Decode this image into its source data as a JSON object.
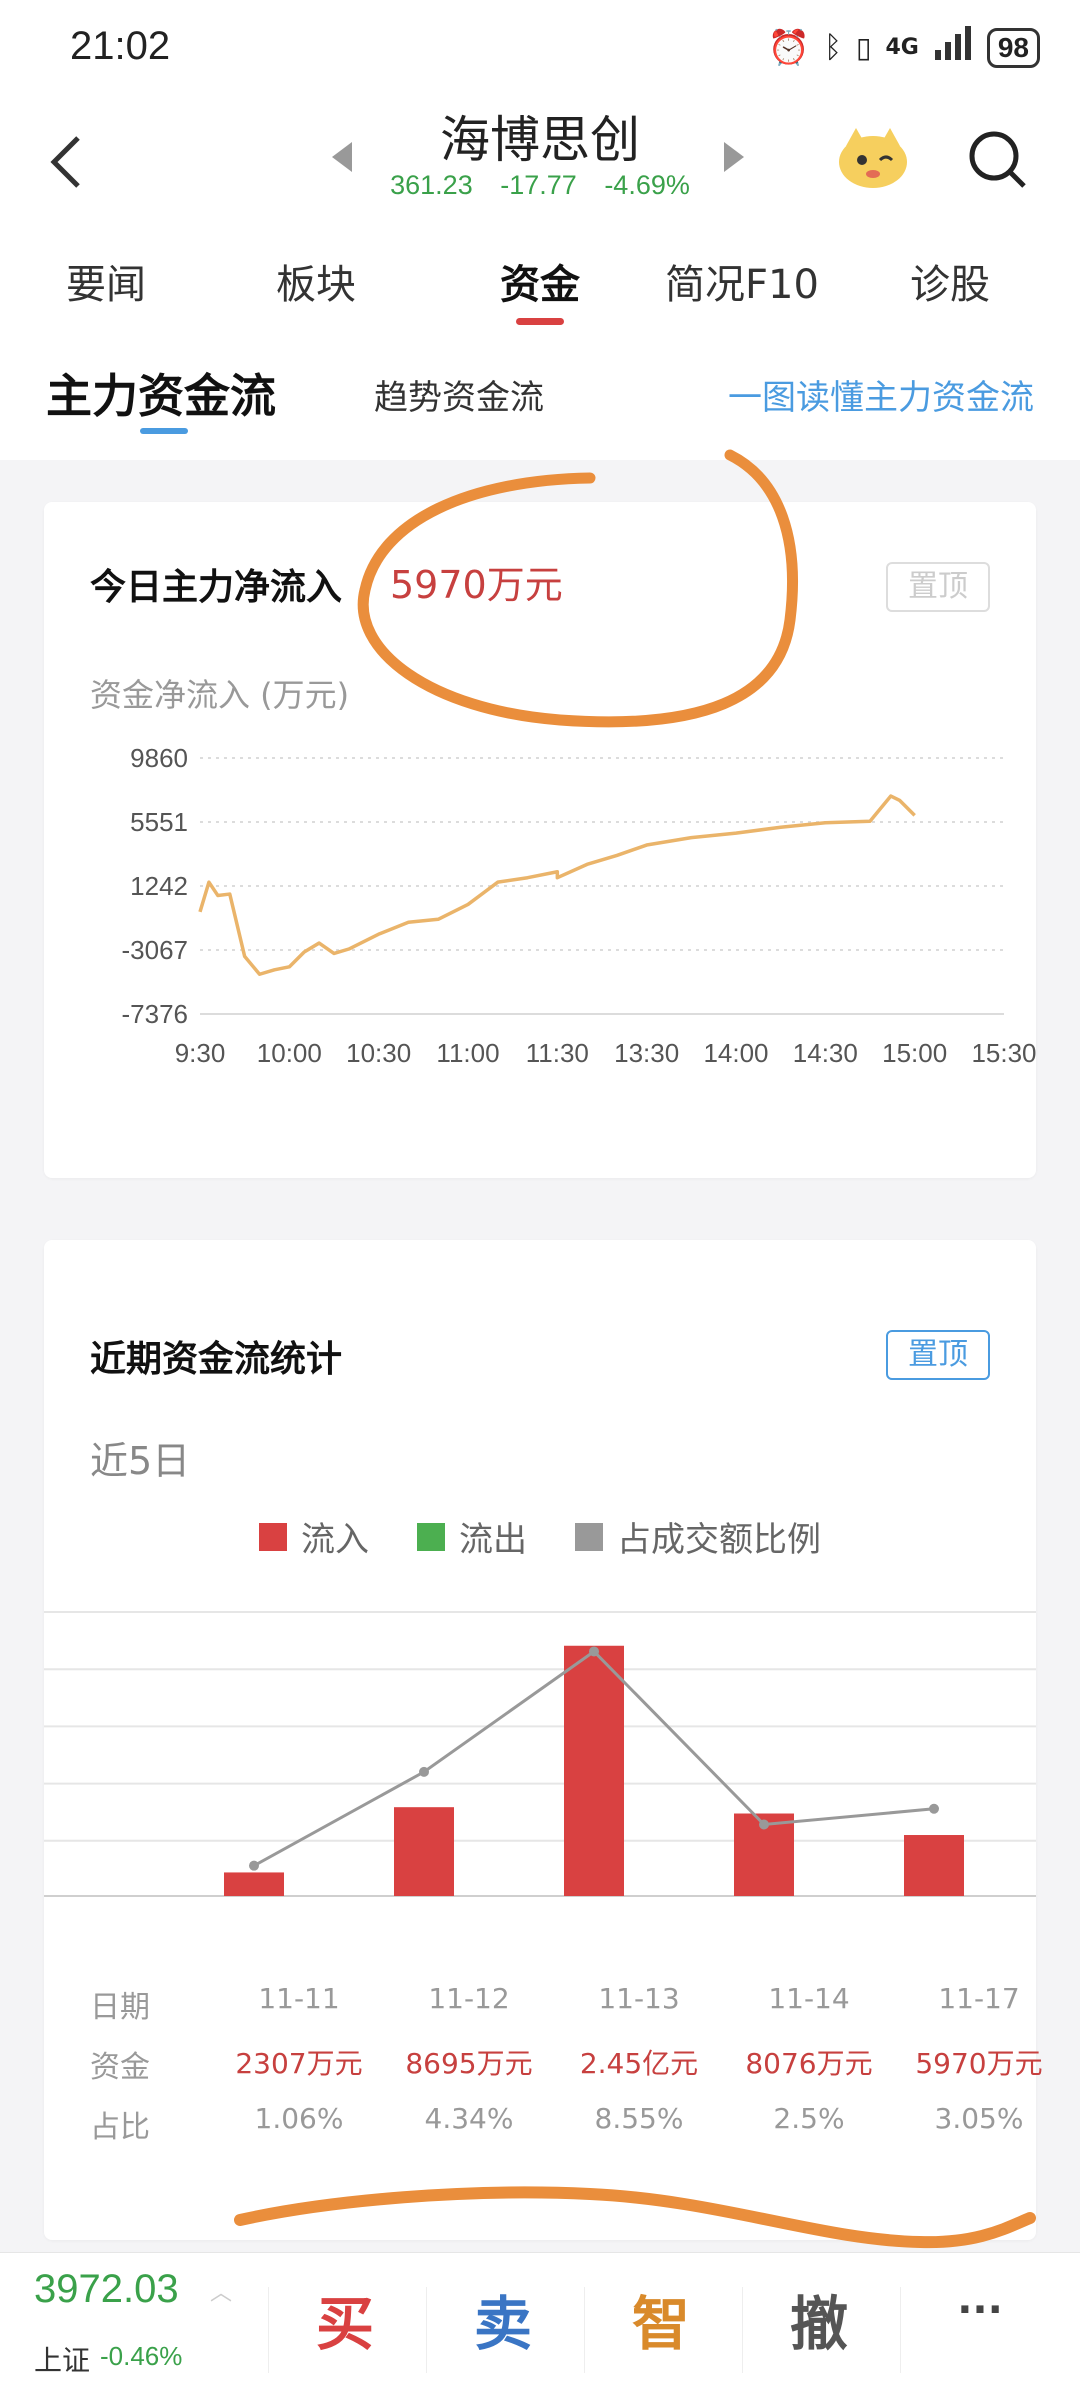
{
  "status_bar": {
    "time": "21:02",
    "battery": "98",
    "network": "4G"
  },
  "header": {
    "stock_name": "海博思创",
    "price": "361.23",
    "change": "-17.77",
    "change_pct": "-4.69%"
  },
  "tabs": [
    "要闻",
    "板块",
    "资金",
    "简况F10",
    "诊股"
  ],
  "active_tab": "资金",
  "subtabs": {
    "main": "主力资金流",
    "trend": "趋势资金流",
    "link": "一图读懂主力资金流"
  },
  "card1": {
    "title": "今日主力净流入",
    "value": "5970万元",
    "pin_label": "置顶",
    "axis_unit": "资金净流入 (万元)"
  },
  "card2": {
    "title": "近期资金流统计",
    "pin_label": "置顶",
    "period": "近5日",
    "legend": [
      {
        "label": "流入",
        "color": "#d94141"
      },
      {
        "label": "流出",
        "color": "#4caf50"
      },
      {
        "label": "占成交额比例",
        "color": "#999999"
      }
    ],
    "row_labels": {
      "date": "日期",
      "amount": "资金",
      "ratio": "占比"
    },
    "dates": [
      "11-11",
      "11-12",
      "11-13",
      "11-14",
      "11-17"
    ],
    "amounts": [
      "2307万元",
      "8695万元",
      "2.45亿元",
      "8076万元",
      "5970万元"
    ],
    "ratios": [
      "1.06%",
      "4.34%",
      "8.55%",
      "2.5%",
      "3.05%"
    ]
  },
  "chart_data": [
    {
      "type": "line",
      "title": "今日主力净流入",
      "ylabel": "资金净流入 (万元)",
      "y_ticks": [
        9860,
        5551,
        1242,
        -3067,
        -7376
      ],
      "ylim": [
        -7376,
        9860
      ],
      "x_ticks": [
        "9:30",
        "10:00",
        "10:30",
        "11:00",
        "11:30",
        "13:30",
        "14:00",
        "14:30",
        "15:00",
        "15:30"
      ],
      "series": [
        {
          "color": "#eab46a",
          "x": [
            "9:30",
            "9:33",
            "9:36",
            "9:40",
            "9:45",
            "9:50",
            "9:55",
            "10:00",
            "10:05",
            "10:10",
            "10:15",
            "10:20",
            "10:30",
            "10:40",
            "10:50",
            "11:00",
            "11:10",
            "11:20",
            "11:30",
            "13:00",
            "13:10",
            "13:20",
            "13:30",
            "13:45",
            "14:00",
            "14:15",
            "14:30",
            "14:45",
            "14:52",
            "14:55",
            "15:00"
          ],
          "values": [
            -500,
            1500,
            600,
            700,
            -3500,
            -4700,
            -4400,
            -4200,
            -3200,
            -2600,
            -3300,
            -3000,
            -2000,
            -1200,
            -1000,
            0,
            1500,
            1800,
            2200,
            1800,
            2700,
            3300,
            4000,
            4500,
            4800,
            5200,
            5500,
            5600,
            7300,
            7000,
            6000
          ]
        }
      ],
      "grid": true
    },
    {
      "type": "bar",
      "title": "近期资金流统计",
      "categories": [
        "11-11",
        "11-12",
        "11-13",
        "11-14",
        "11-17"
      ],
      "series": [
        {
          "name": "流入",
          "values": [
            2307,
            8695,
            24500,
            8076,
            5970
          ],
          "color": "#d94141"
        },
        {
          "name": "占成交额比例",
          "type": "line",
          "values": [
            1.06,
            4.34,
            8.55,
            2.5,
            3.05
          ],
          "color": "#999999"
        }
      ],
      "grid": true
    }
  ]
}
